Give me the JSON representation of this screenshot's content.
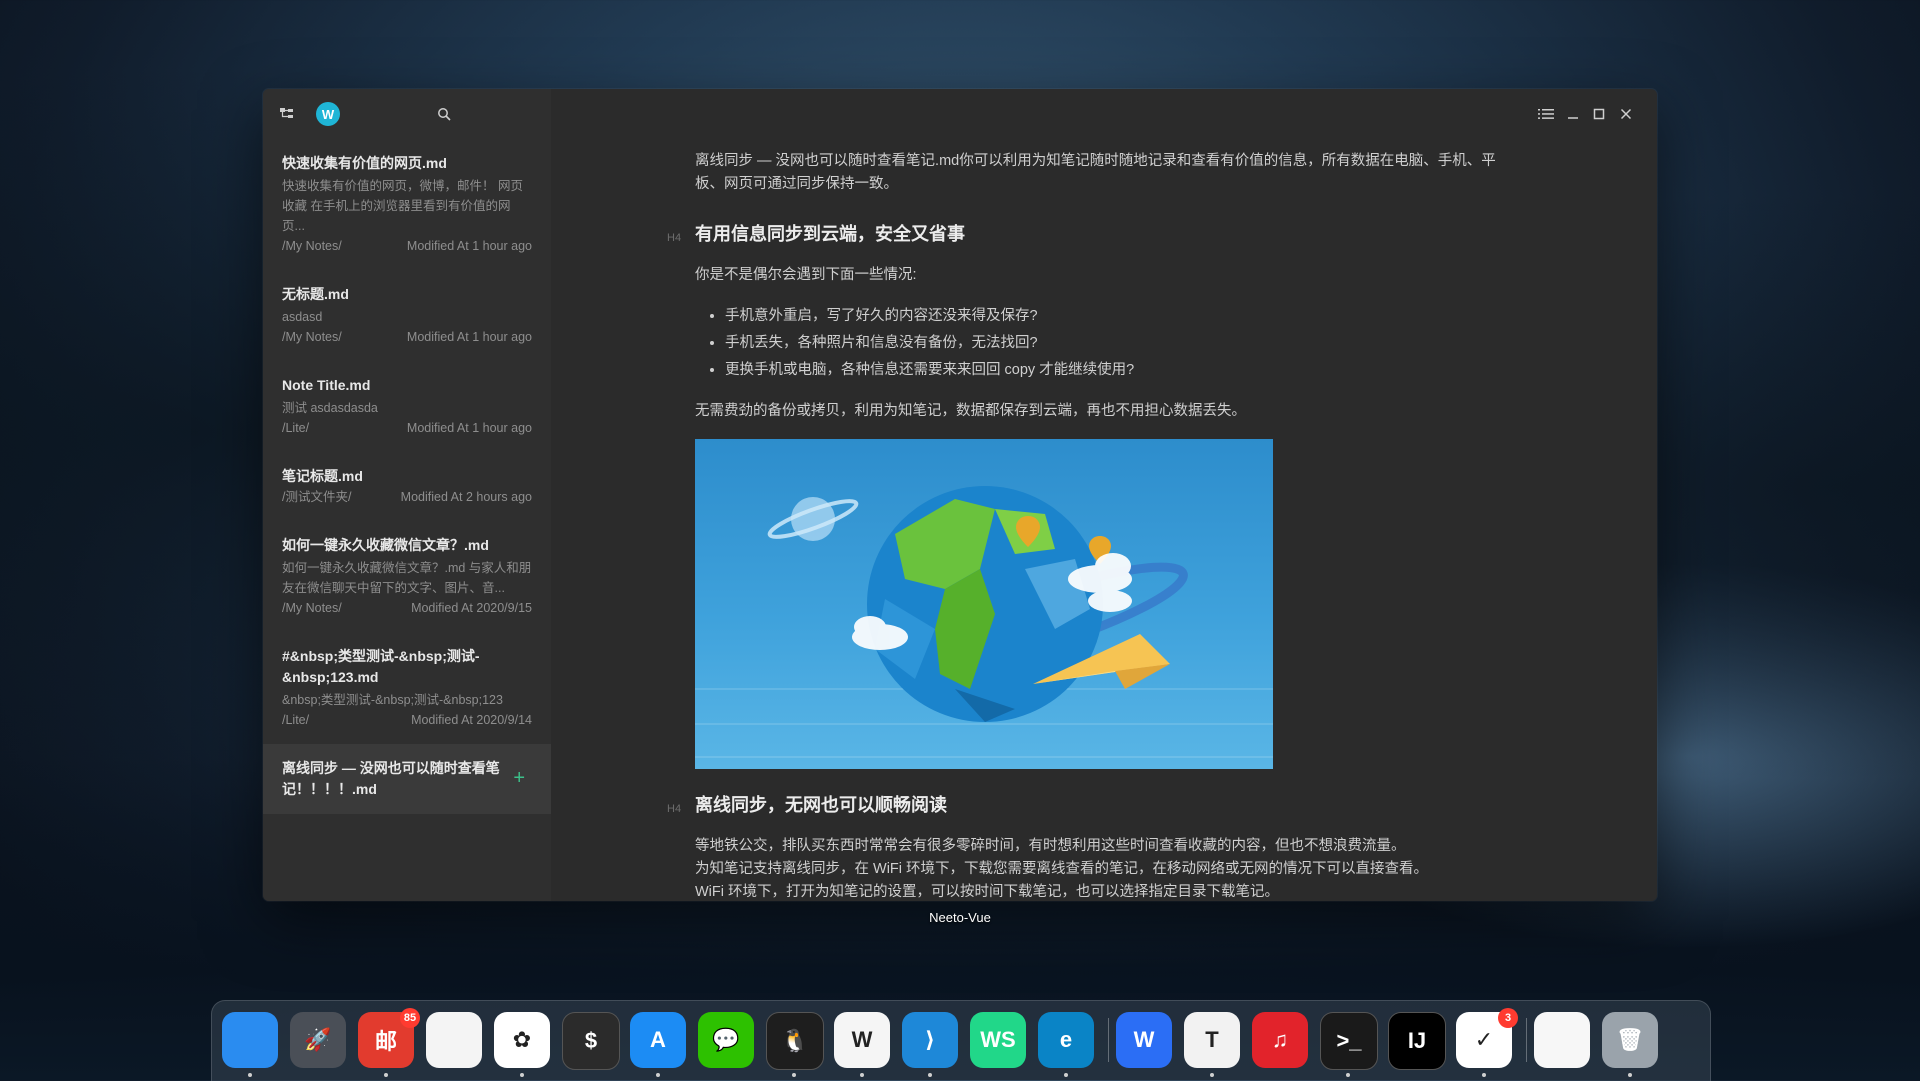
{
  "window": {
    "avatar_letter": "W",
    "dock_tooltip": "Neeto-Vue"
  },
  "sidebar": {
    "notes": [
      {
        "title": "快速收集有价值的网页.md",
        "excerpt": "快速收集有价值的网页，微博，邮件！ 网页收藏 在手机上的浏览器里看到有价值的网页...",
        "folder": "/My Notes/",
        "modified": "Modified At 1 hour ago"
      },
      {
        "title": "无标题.md",
        "excerpt": "asdasd",
        "folder": "/My Notes/",
        "modified": "Modified At 1 hour ago"
      },
      {
        "title": "Note Title.md",
        "excerpt": "测试 asdasdasda",
        "folder": "/Lite/",
        "modified": "Modified At 1 hour ago"
      },
      {
        "title": "笔记标题.md",
        "excerpt": "",
        "folder": "/测试文件夹/",
        "modified": "Modified At 2 hours ago"
      },
      {
        "title": "如何一键永久收藏微信文章？.md",
        "excerpt": "如何一键永久收藏微信文章？.md 与家人和朋友在微信聊天中留下的文字、图片、音...",
        "folder": "/My Notes/",
        "modified": "Modified At 2020/9/15"
      },
      {
        "title": "#&nbsp;类型测试-&nbsp;测试-&nbsp;123.md",
        "excerpt": "&nbsp;类型测试-&nbsp;测试-&nbsp;123",
        "folder": "/Lite/",
        "modified": "Modified At 2020/9/14"
      },
      {
        "title": "离线同步 — 没网也可以随时查看笔记！！！！.md",
        "excerpt": "",
        "folder": "",
        "modified": ""
      }
    ],
    "add_symbol": "+"
  },
  "document": {
    "intro": "离线同步 — 没网也可以随时查看笔记.md你可以利用为知笔记随时随地记录和查看有价值的信息，所有数据在电脑、手机、平板、网页可通过同步保持一致。",
    "h4_marker": "H4",
    "section1_heading": "有用信息同步到云端，安全又省事",
    "section1_lead": "你是不是偶尔会遇到下面一些情况:",
    "bullets": [
      "手机意外重启，写了好久的内容还没来得及保存?",
      "手机丢失，各种照片和信息没有备份，无法找回?",
      "更换手机或电脑，各种信息还需要来来回回 copy 才能继续使用?"
    ],
    "section1_tail": "无需费劲的备份或拷贝，利用为知笔记，数据都保存到云端，再也不用担心数据丢失。",
    "section2_heading": "离线同步，无网也可以顺畅阅读",
    "section2_lines": [
      "等地铁公交，排队买东西时常常会有很多零碎时间，有时想利用这些时间查看收藏的内容，但也不想浪费流量。",
      "为知笔记支持离线同步，在 WiFi 环境下，下载您需要离线查看的笔记，在移动网络或无网的情况下可以直接查看。",
      "WiFi 环境下，打开为知笔记的设置，可以按时间下载笔记，也可以选择指定目录下载笔记。"
    ]
  },
  "dock": {
    "apps": [
      {
        "name": "finder",
        "glyph": "",
        "color": "#2a8cf0"
      },
      {
        "name": "launchpad",
        "glyph": "🚀",
        "color": "#4a4f57"
      },
      {
        "name": "netease-mail",
        "glyph": "邮",
        "color": "#e23b2e",
        "badge": "85"
      },
      {
        "name": "reminders",
        "glyph": "",
        "color": "#f4f4f4"
      },
      {
        "name": "photos",
        "glyph": "✿",
        "color": "#ffffff"
      },
      {
        "name": "terminal-dark",
        "glyph": "$",
        "color": "#2b2b2b"
      },
      {
        "name": "app-store",
        "glyph": "A",
        "color": "#1c8cf4"
      },
      {
        "name": "wechat",
        "glyph": "💬",
        "color": "#2dc100"
      },
      {
        "name": "qq",
        "glyph": "🐧",
        "color": "#1e1e1e"
      },
      {
        "name": "wiznote",
        "glyph": "W",
        "color": "#f5f5f5"
      },
      {
        "name": "vscode",
        "glyph": "⟩",
        "color": "#1e88d8"
      },
      {
        "name": "webstorm",
        "glyph": "WS",
        "color": "#21d789"
      },
      {
        "name": "edge",
        "glyph": "e",
        "color": "#0a84c6"
      },
      {
        "name": "wps",
        "glyph": "W",
        "color": "#2b6ef5"
      },
      {
        "name": "typora",
        "glyph": "T",
        "color": "#f2f2f2"
      },
      {
        "name": "netease-music",
        "glyph": "♫",
        "color": "#e2232b"
      },
      {
        "name": "terminal",
        "glyph": ">_",
        "color": "#1a1a1a"
      },
      {
        "name": "intellij",
        "glyph": "IJ",
        "color": "#000000"
      },
      {
        "name": "ticktick",
        "glyph": "✓",
        "color": "#ffffff",
        "badge": "3"
      },
      {
        "name": "document",
        "glyph": "",
        "color": "#f7f7f7"
      },
      {
        "name": "trash",
        "glyph": "🗑",
        "color": "#9aa3ab"
      }
    ]
  }
}
